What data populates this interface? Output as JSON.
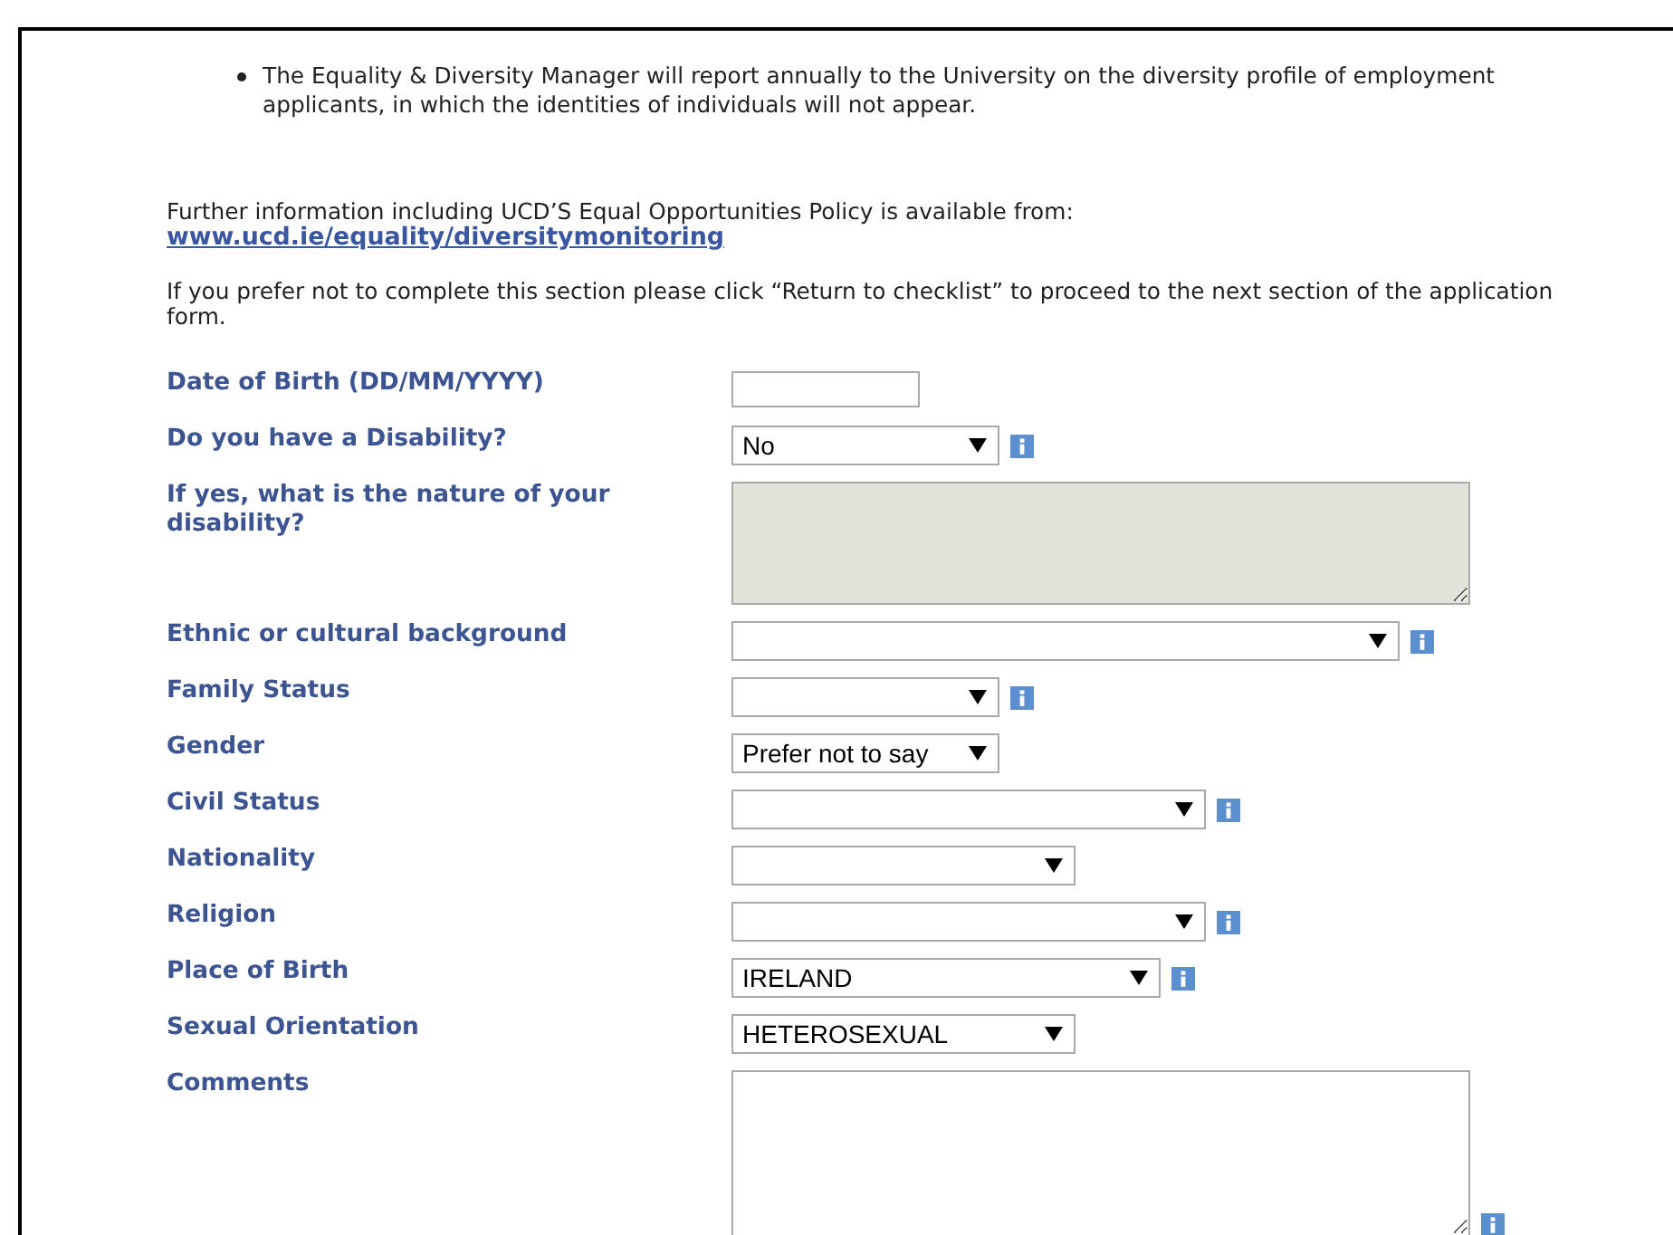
{
  "bullets": [
    {
      "text": "The Equality & Diversity Manager will report annually to the University on the diversity profile of employment applicants, in which the identities of individuals will not appear."
    }
  ],
  "further_info": {
    "text": "Further information including UCD’S Equal Opportunities Policy is available from:",
    "link": "www.ucd.ie/equality/diversitymonitoring"
  },
  "note": "If you prefer not to complete this section please click “Return to checklist” to proceed to the next section of the application form.",
  "fields": [
    {
      "label": "Date of Birth (DD/MM/YYYY)",
      "kind": "text",
      "info": false
    },
    {
      "label": "Do you have a Disability?",
      "kind": "select",
      "value": "No",
      "info": true
    },
    {
      "label": "If yes, what is the nature of your disability?",
      "kind": "textarea",
      "disabled": true,
      "info": false
    },
    {
      "label": "Ethnic or cultural background",
      "kind": "select",
      "info": true
    },
    {
      "label": "Family Status",
      "kind": "select",
      "info": true
    },
    {
      "label": "Gender",
      "kind": "select",
      "value": "Prefer not to say",
      "info": false
    },
    {
      "label": "Civil Status",
      "kind": "select",
      "info": true
    },
    {
      "label": "Nationality",
      "kind": "select",
      "info": false
    },
    {
      "label": "Religion",
      "kind": "select",
      "info": true
    },
    {
      "label": "Place of Birth",
      "kind": "select",
      "value": "IRELAND",
      "info": true
    },
    {
      "label": "Sexual Orientation",
      "kind": "select",
      "value": "HETEROSEXUAL",
      "info": false
    },
    {
      "label": "Comments",
      "kind": "textarea",
      "disabled": false,
      "info": true
    }
  ]
}
